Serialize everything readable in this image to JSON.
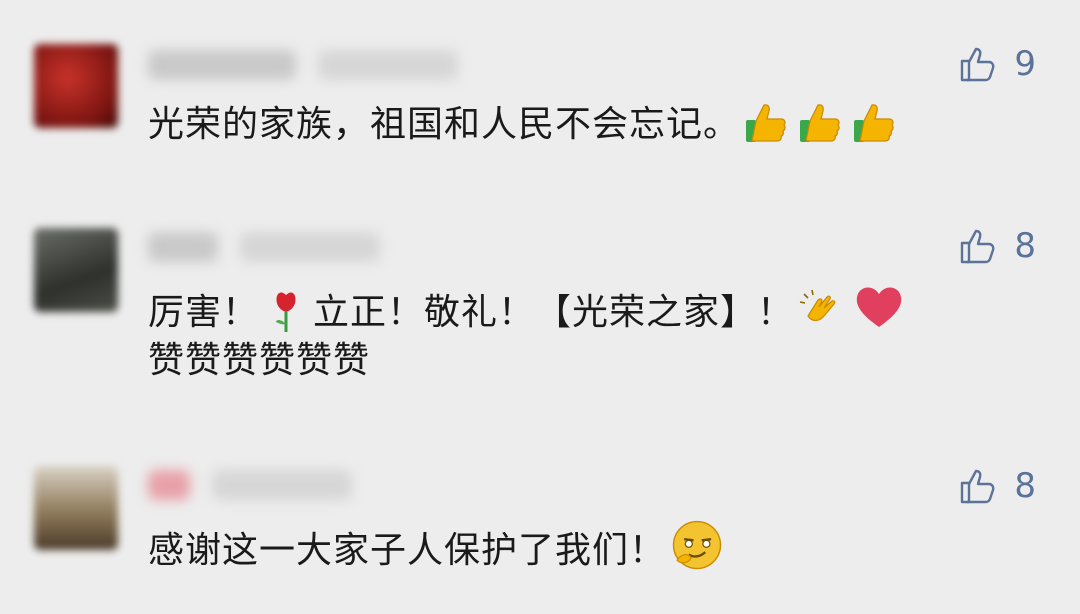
{
  "comments": [
    {
      "like_count": "9",
      "text": "光荣的家族，祖国和人民不会忘记。",
      "emojis": [
        "thumbs-up",
        "thumbs-up",
        "thumbs-up"
      ]
    },
    {
      "like_count": "8",
      "text_parts": [
        "厉害！",
        "立正！敬礼！【光荣之家】！",
        "赞赞赞赞赞赞"
      ],
      "emojis": [
        "rose",
        "clapping-hands",
        "heart"
      ]
    },
    {
      "like_count": "8",
      "text": "感谢这一大家子人保护了我们！",
      "emojis": [
        "smirk-face"
      ]
    }
  ],
  "colors": {
    "background": "#ededed",
    "like": "#5b7299",
    "text": "#1a1a1a",
    "heart": "#e0405d",
    "thumb": "#f4b400",
    "thumb_cuff": "#3aa84a"
  },
  "icons": [
    "thumbs-up-outline-icon",
    "thumbs-up-emoji",
    "rose-emoji",
    "clapping-hands-emoji",
    "heart-emoji",
    "smirk-face-emoji"
  ]
}
